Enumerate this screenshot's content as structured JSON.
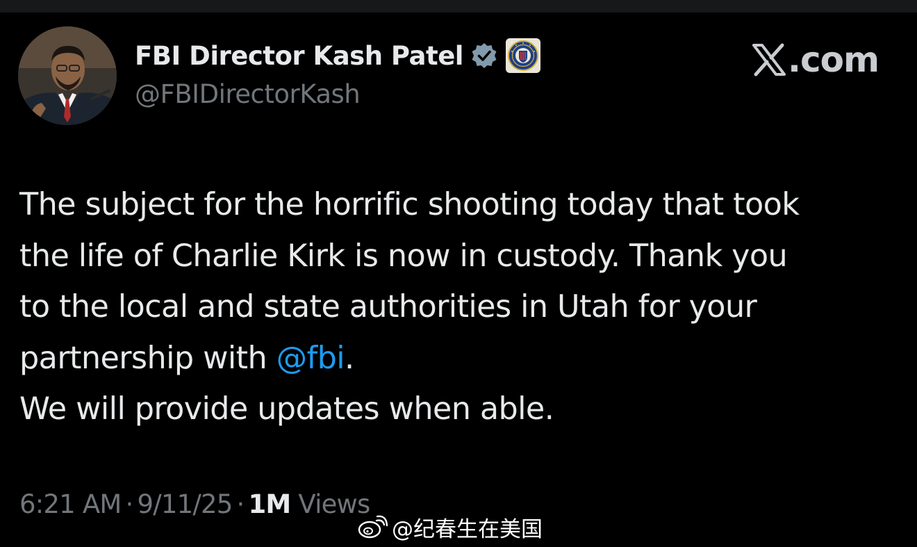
{
  "tweet": {
    "display_name": "FBI Director Kash Patel",
    "handle": "@FBIDirectorKash",
    "brand": "X.com",
    "body_lines": [
      "The subject for the horrific shooting today that took",
      "the life of Charlie Kirk is now in custody. Thank you",
      "to the local and state authorities in Utah for your"
    ],
    "body_line4_prefix": "partnership with ",
    "mention": "@fbi",
    "body_line4_suffix": ".",
    "body_line5": "We will provide updates when able.",
    "time": "6:21 AM",
    "date": "9/11/25",
    "separator": "·",
    "views_count": "1M",
    "views_label": "Views"
  },
  "watermark": {
    "text": "@纪春生在美国",
    "icon": "weibo-icon"
  },
  "icons": {
    "verified": "verified-badge-icon",
    "affiliation": "fbi-seal-icon",
    "brand": "x-logo-icon"
  },
  "colors": {
    "background": "#000000",
    "text": "#e7e9ea",
    "secondary_text": "#71767b",
    "mention": "#1d9bf0",
    "verified_badge": "#829aab"
  }
}
